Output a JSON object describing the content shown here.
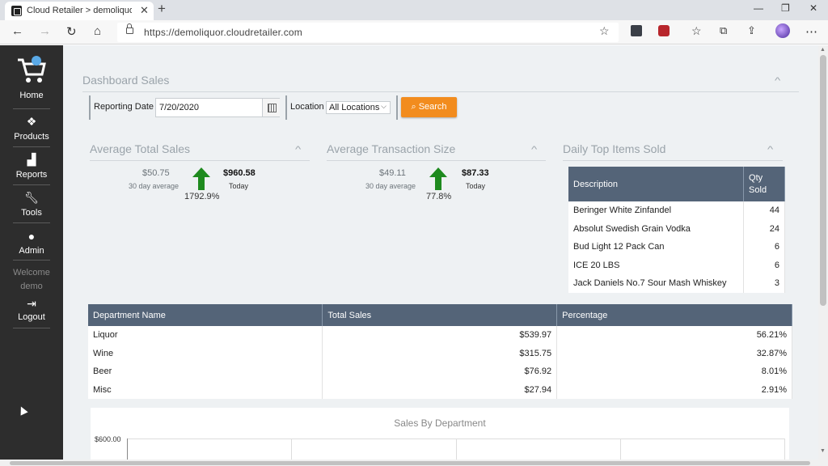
{
  "browser": {
    "tab_title": "Cloud Retailer > demoliquor > H",
    "url": "https://demoliquor.cloudretailer.com"
  },
  "sidebar": {
    "items": [
      {
        "label": "Home",
        "icon": "cart-logo-icon"
      },
      {
        "label": "Products",
        "icon": "boxes-icon"
      },
      {
        "label": "Reports",
        "icon": "bar-chart-icon"
      },
      {
        "label": "Tools",
        "icon": "wrench-icon"
      },
      {
        "label": "Admin",
        "icon": "user-icon"
      }
    ],
    "welcome": "Welcome",
    "username": "demo",
    "logout": "Logout"
  },
  "dashboard": {
    "title": "Dashboard Sales",
    "reporting_date_label": "Reporting Date",
    "reporting_date_value": "7/20/2020",
    "location_label": "Location",
    "location_value": "All Locations",
    "search_label": "Search"
  },
  "avg_total_sales": {
    "title": "Average Total Sales",
    "avg_value": "$50.75",
    "avg_label": "30 day average",
    "today_value": "$960.58",
    "today_label": "Today",
    "change": "1792.9%"
  },
  "avg_transaction": {
    "title": "Average Transaction Size",
    "avg_value": "$49.11",
    "avg_label": "30 day average",
    "today_value": "$87.33",
    "today_label": "Today",
    "change": "77.8%"
  },
  "top_items": {
    "title": "Daily Top Items Sold",
    "headers": {
      "description": "Description",
      "qty_line1": "Qty",
      "qty_line2": "Sold"
    },
    "rows": [
      {
        "description": "Beringer White Zinfandel",
        "qty": "44"
      },
      {
        "description": "Absolut Swedish Grain Vodka",
        "qty": "24"
      },
      {
        "description": "Bud Light 12 Pack Can",
        "qty": "6"
      },
      {
        "description": "ICE 20 LBS",
        "qty": "6"
      },
      {
        "description": "Jack Daniels No.7 Sour Mash Whiskey",
        "qty": "3"
      }
    ]
  },
  "departments": {
    "headers": {
      "name": "Department Name",
      "total": "Total Sales",
      "pct": "Percentage"
    },
    "rows": [
      {
        "name": "Liquor",
        "total": "$539.97",
        "pct": "56.21%"
      },
      {
        "name": "Wine",
        "total": "$315.75",
        "pct": "32.87%"
      },
      {
        "name": "Beer",
        "total": "$76.92",
        "pct": "8.01%"
      },
      {
        "name": "Misc",
        "total": "$27.94",
        "pct": "2.91%"
      }
    ]
  },
  "chart": {
    "title": "Sales By Department",
    "y_top_tick": "$600.00"
  },
  "colors": {
    "sidebar": "#2d2d2d",
    "table_header": "#546478",
    "search_button": "#f28c1e",
    "up_arrow": "#1e8a1e"
  }
}
